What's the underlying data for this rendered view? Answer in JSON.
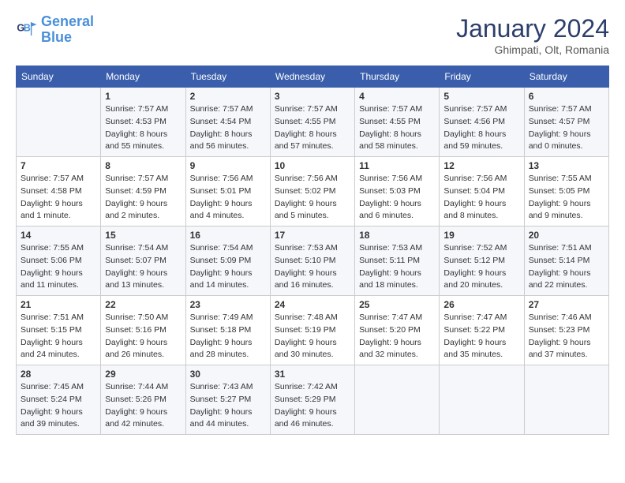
{
  "header": {
    "logo_line1": "General",
    "logo_line2": "Blue",
    "month": "January 2024",
    "location": "Ghimpati, Olt, Romania"
  },
  "days_of_week": [
    "Sunday",
    "Monday",
    "Tuesday",
    "Wednesday",
    "Thursday",
    "Friday",
    "Saturday"
  ],
  "weeks": [
    [
      {
        "day": "",
        "info": ""
      },
      {
        "day": "1",
        "info": "Sunrise: 7:57 AM\nSunset: 4:53 PM\nDaylight: 8 hours\nand 55 minutes."
      },
      {
        "day": "2",
        "info": "Sunrise: 7:57 AM\nSunset: 4:54 PM\nDaylight: 8 hours\nand 56 minutes."
      },
      {
        "day": "3",
        "info": "Sunrise: 7:57 AM\nSunset: 4:55 PM\nDaylight: 8 hours\nand 57 minutes."
      },
      {
        "day": "4",
        "info": "Sunrise: 7:57 AM\nSunset: 4:55 PM\nDaylight: 8 hours\nand 58 minutes."
      },
      {
        "day": "5",
        "info": "Sunrise: 7:57 AM\nSunset: 4:56 PM\nDaylight: 8 hours\nand 59 minutes."
      },
      {
        "day": "6",
        "info": "Sunrise: 7:57 AM\nSunset: 4:57 PM\nDaylight: 9 hours\nand 0 minutes."
      }
    ],
    [
      {
        "day": "7",
        "info": "Sunrise: 7:57 AM\nSunset: 4:58 PM\nDaylight: 9 hours\nand 1 minute."
      },
      {
        "day": "8",
        "info": "Sunrise: 7:57 AM\nSunset: 4:59 PM\nDaylight: 9 hours\nand 2 minutes."
      },
      {
        "day": "9",
        "info": "Sunrise: 7:56 AM\nSunset: 5:01 PM\nDaylight: 9 hours\nand 4 minutes."
      },
      {
        "day": "10",
        "info": "Sunrise: 7:56 AM\nSunset: 5:02 PM\nDaylight: 9 hours\nand 5 minutes."
      },
      {
        "day": "11",
        "info": "Sunrise: 7:56 AM\nSunset: 5:03 PM\nDaylight: 9 hours\nand 6 minutes."
      },
      {
        "day": "12",
        "info": "Sunrise: 7:56 AM\nSunset: 5:04 PM\nDaylight: 9 hours\nand 8 minutes."
      },
      {
        "day": "13",
        "info": "Sunrise: 7:55 AM\nSunset: 5:05 PM\nDaylight: 9 hours\nand 9 minutes."
      }
    ],
    [
      {
        "day": "14",
        "info": "Sunrise: 7:55 AM\nSunset: 5:06 PM\nDaylight: 9 hours\nand 11 minutes."
      },
      {
        "day": "15",
        "info": "Sunrise: 7:54 AM\nSunset: 5:07 PM\nDaylight: 9 hours\nand 13 minutes."
      },
      {
        "day": "16",
        "info": "Sunrise: 7:54 AM\nSunset: 5:09 PM\nDaylight: 9 hours\nand 14 minutes."
      },
      {
        "day": "17",
        "info": "Sunrise: 7:53 AM\nSunset: 5:10 PM\nDaylight: 9 hours\nand 16 minutes."
      },
      {
        "day": "18",
        "info": "Sunrise: 7:53 AM\nSunset: 5:11 PM\nDaylight: 9 hours\nand 18 minutes."
      },
      {
        "day": "19",
        "info": "Sunrise: 7:52 AM\nSunset: 5:12 PM\nDaylight: 9 hours\nand 20 minutes."
      },
      {
        "day": "20",
        "info": "Sunrise: 7:51 AM\nSunset: 5:14 PM\nDaylight: 9 hours\nand 22 minutes."
      }
    ],
    [
      {
        "day": "21",
        "info": "Sunrise: 7:51 AM\nSunset: 5:15 PM\nDaylight: 9 hours\nand 24 minutes."
      },
      {
        "day": "22",
        "info": "Sunrise: 7:50 AM\nSunset: 5:16 PM\nDaylight: 9 hours\nand 26 minutes."
      },
      {
        "day": "23",
        "info": "Sunrise: 7:49 AM\nSunset: 5:18 PM\nDaylight: 9 hours\nand 28 minutes."
      },
      {
        "day": "24",
        "info": "Sunrise: 7:48 AM\nSunset: 5:19 PM\nDaylight: 9 hours\nand 30 minutes."
      },
      {
        "day": "25",
        "info": "Sunrise: 7:47 AM\nSunset: 5:20 PM\nDaylight: 9 hours\nand 32 minutes."
      },
      {
        "day": "26",
        "info": "Sunrise: 7:47 AM\nSunset: 5:22 PM\nDaylight: 9 hours\nand 35 minutes."
      },
      {
        "day": "27",
        "info": "Sunrise: 7:46 AM\nSunset: 5:23 PM\nDaylight: 9 hours\nand 37 minutes."
      }
    ],
    [
      {
        "day": "28",
        "info": "Sunrise: 7:45 AM\nSunset: 5:24 PM\nDaylight: 9 hours\nand 39 minutes."
      },
      {
        "day": "29",
        "info": "Sunrise: 7:44 AM\nSunset: 5:26 PM\nDaylight: 9 hours\nand 42 minutes."
      },
      {
        "day": "30",
        "info": "Sunrise: 7:43 AM\nSunset: 5:27 PM\nDaylight: 9 hours\nand 44 minutes."
      },
      {
        "day": "31",
        "info": "Sunrise: 7:42 AM\nSunset: 5:29 PM\nDaylight: 9 hours\nand 46 minutes."
      },
      {
        "day": "",
        "info": ""
      },
      {
        "day": "",
        "info": ""
      },
      {
        "day": "",
        "info": ""
      }
    ]
  ]
}
